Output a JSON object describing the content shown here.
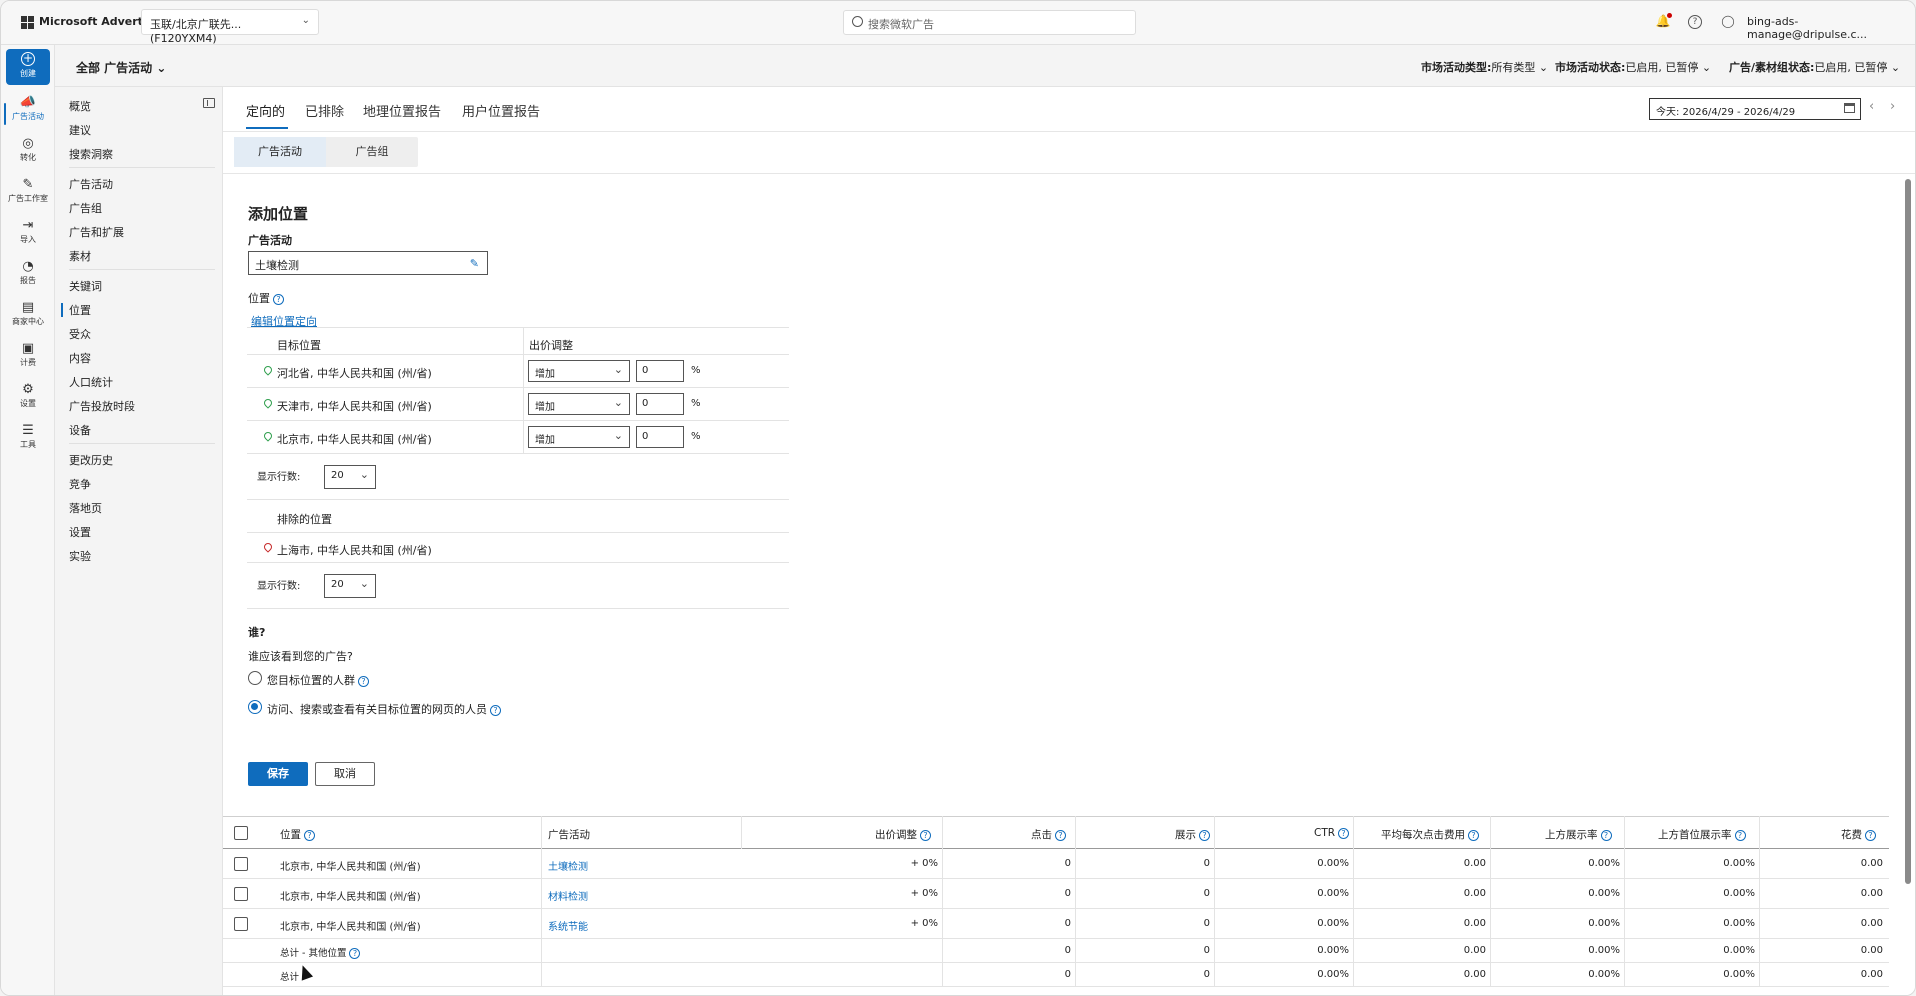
{
  "topbar": {
    "brand": "Microsoft Advertising",
    "account": "玉联/北京广联先... (F120YXM4)",
    "search_placeholder": "搜索微软广告",
    "user_email": "bing-ads-manage@dripulse.c..."
  },
  "subheader": {
    "scope": "全部 广告活动",
    "filters": [
      {
        "label": "市场活动类型:",
        "value": "所有类型"
      },
      {
        "label": "市场活动状态:",
        "value": "已启用, 已暂停"
      },
      {
        "label": "广告/素材组状态:",
        "value": "已启用, 已暂停"
      }
    ]
  },
  "rail": {
    "create": "创建",
    "items": [
      {
        "label": "广告活动",
        "icon": "megaphone-icon",
        "glyph": "📣"
      },
      {
        "label": "转化",
        "icon": "target-icon",
        "glyph": "◎"
      },
      {
        "label": "广告工作室",
        "icon": "studio-icon",
        "glyph": "✎"
      },
      {
        "label": "导入",
        "icon": "import-icon",
        "glyph": "⇥"
      },
      {
        "label": "报告",
        "icon": "report-icon",
        "glyph": "◔"
      },
      {
        "label": "商家中心",
        "icon": "store-icon",
        "glyph": "▤"
      },
      {
        "label": "计费",
        "icon": "billing-icon",
        "glyph": "▣"
      },
      {
        "label": "设置",
        "icon": "gear-icon",
        "glyph": "⚙"
      },
      {
        "label": "工具",
        "icon": "tools-icon",
        "glyph": "☰"
      }
    ]
  },
  "nav": {
    "group1": [
      "概览",
      "建议",
      "搜索洞察"
    ],
    "group2": [
      "广告活动",
      "广告组",
      "广告和扩展",
      "素材"
    ],
    "group3": [
      "关键词",
      "位置",
      "受众",
      "内容",
      "人口统计",
      "广告投放时段",
      "设备"
    ],
    "group4": [
      "更改历史",
      "竞争",
      "落地页",
      "设置",
      "实验"
    ]
  },
  "tabs": [
    "定向的",
    "已排除",
    "地理位置报告",
    "用户位置报告"
  ],
  "date_range": "今天: 2026/4/29 - 2026/4/29",
  "subtabs": [
    "广告活动",
    "广告组"
  ],
  "form": {
    "title": "添加位置",
    "campaign_label": "广告活动",
    "campaign_value": "土壤检测",
    "location_label": "位置",
    "edit_link": "编辑位置定向",
    "col_target": "目标位置",
    "col_bid": "出价调整",
    "targets": [
      {
        "name": "河北省, 中华人民共和国 (州/省)",
        "bid_type": "增加",
        "bid_value": "0",
        "unit": "%"
      },
      {
        "name": "天津市, 中华人民共和国 (州/省)",
        "bid_type": "增加",
        "bid_value": "0",
        "unit": "%"
      },
      {
        "name": "北京市, 中华人民共和国 (州/省)",
        "bid_type": "增加",
        "bid_value": "0",
        "unit": "%"
      }
    ],
    "rows_label": "显示行数:",
    "rows_value": "20",
    "excluded_header": "排除的位置",
    "excluded": [
      {
        "name": "上海市, 中华人民共和国 (州/省)"
      }
    ],
    "who_title": "谁?",
    "who_question": "谁应该看到您的广告?",
    "who_options": [
      {
        "label": "您目标位置的人群",
        "selected": false
      },
      {
        "label": "访问、搜索或查看有关目标位置的网页的人员",
        "selected": true
      }
    ],
    "save": "保存",
    "cancel": "取消"
  },
  "grid": {
    "headers": [
      "位置",
      "广告活动",
      "出价调整",
      "点击",
      "展示",
      "CTR",
      "平均每次点击费用",
      "上方展示率",
      "上方首位展示率",
      "花费"
    ],
    "rows": [
      {
        "location": "北京市, 中华人民共和国 (州/省)",
        "campaign": "土壤检测",
        "bid": "+ 0%",
        "clicks": "0",
        "impr": "0",
        "ctr": "0.00%",
        "cpc": "0.00",
        "top": "0.00%",
        "abs_top": "0.00%",
        "spend": "0.00"
      },
      {
        "location": "北京市, 中华人民共和国 (州/省)",
        "campaign": "材料检测",
        "bid": "+ 0%",
        "clicks": "0",
        "impr": "0",
        "ctr": "0.00%",
        "cpc": "0.00",
        "top": "0.00%",
        "abs_top": "0.00%",
        "spend": "0.00"
      },
      {
        "location": "北京市, 中华人民共和国 (州/省)",
        "campaign": "系统节能",
        "bid": "+ 0%",
        "clicks": "0",
        "impr": "0",
        "ctr": "0.00%",
        "cpc": "0.00",
        "top": "0.00%",
        "abs_top": "0.00%",
        "spend": "0.00"
      }
    ],
    "totals": [
      {
        "label": "总计 - 其他位置",
        "clicks": "0",
        "impr": "0",
        "ctr": "0.00%",
        "cpc": "0.00",
        "top": "0.00%",
        "abs_top": "0.00%",
        "spend": "0.00"
      },
      {
        "label": "总计",
        "clicks": "0",
        "impr": "0",
        "ctr": "0.00%",
        "cpc": "0.00",
        "top": "0.00%",
        "abs_top": "0.00%",
        "spend": "0.00"
      }
    ]
  },
  "colors": {
    "accent": "#0f6cbd",
    "pin_target": "#2e9e4c",
    "pin_excluded": "#c62828"
  }
}
